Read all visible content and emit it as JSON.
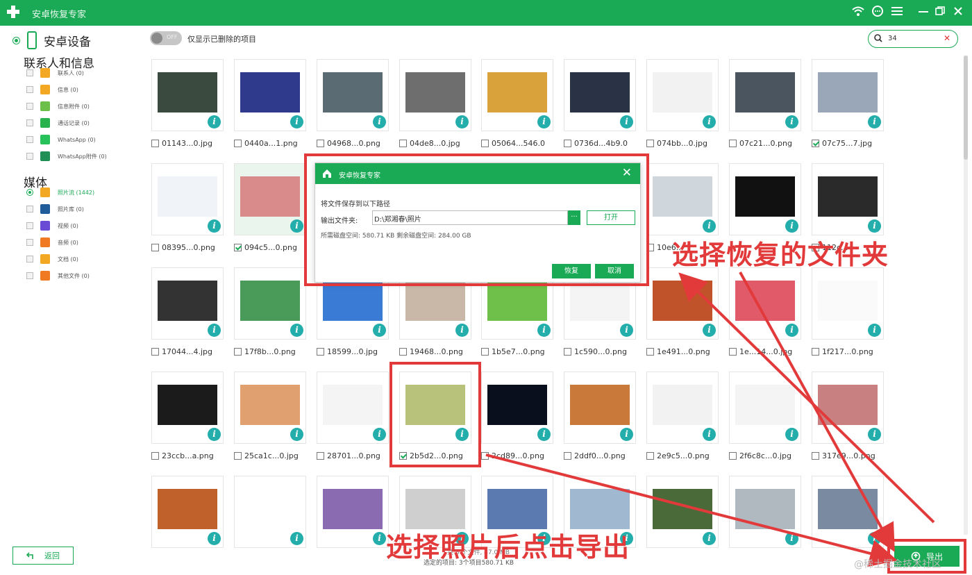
{
  "window": {
    "title": "安卓恢复专家"
  },
  "sidebar": {
    "device_label": "安卓设备",
    "sections": [
      {
        "title": "联系人和信息",
        "items": [
          {
            "label": "联系人 (0)",
            "color": "#f2a822"
          },
          {
            "label": "信息 (0)",
            "color": "#f2a822"
          },
          {
            "label": "信息附件 (0)",
            "color": "#6cc04a"
          },
          {
            "label": "通话记录 (0)",
            "color": "#2ab24f"
          },
          {
            "label": "WhatsApp (0)",
            "color": "#27c25a"
          },
          {
            "label": "WhatsApp附件 (0)",
            "color": "#1f8f55"
          }
        ]
      },
      {
        "title": "媒体",
        "items": [
          {
            "label": "照片流 (1442)",
            "color": "#f2a822",
            "active": true
          },
          {
            "label": "照片库 (0)",
            "color": "#1f5c99"
          },
          {
            "label": "视频 (0)",
            "color": "#6a4bd6"
          },
          {
            "label": "音频 (0)",
            "color": "#f07a22"
          },
          {
            "label": "文档 (0)",
            "color": "#f2a822"
          },
          {
            "label": "其他文件 (0)",
            "color": "#f07a22"
          }
        ]
      }
    ],
    "back_label": "返回"
  },
  "filter": {
    "toggle_text": "OFF",
    "label": "仅显示已删除的项目"
  },
  "search": {
    "value": "34"
  },
  "files": [
    {
      "name": "01143...0.jpg",
      "checked": false
    },
    {
      "name": "0440a...1.png",
      "checked": false
    },
    {
      "name": "04968...0.png",
      "checked": false
    },
    {
      "name": "04de8...0.jpg",
      "checked": false
    },
    {
      "name": "05064...546.0",
      "checked": false
    },
    {
      "name": "0736d...4b9.0",
      "checked": false
    },
    {
      "name": "074bb...0.jpg",
      "checked": false
    },
    {
      "name": "07c21...0.png",
      "checked": false
    },
    {
      "name": "07c75...7.jpg",
      "checked": true
    },
    {
      "name": "08395...0.png",
      "checked": false
    },
    {
      "name": "094c5...0.png",
      "checked": true
    },
    {
      "name": "",
      "checked": false
    },
    {
      "name": "",
      "checked": false
    },
    {
      "name": "",
      "checked": false
    },
    {
      "name": "",
      "checked": false
    },
    {
      "name": "10e6...",
      "checked": false
    },
    {
      "name": "",
      "checked": false
    },
    {
      "name": "112c...",
      "checked": false
    },
    {
      "name": "17044...4.jpg",
      "checked": false
    },
    {
      "name": "17f8b...0.png",
      "checked": false
    },
    {
      "name": "18599...0.jpg",
      "checked": false
    },
    {
      "name": "19468...0.png",
      "checked": false
    },
    {
      "name": "1b5e7...0.png",
      "checked": false
    },
    {
      "name": "1c590...0.png",
      "checked": false
    },
    {
      "name": "1e491...0.png",
      "checked": false
    },
    {
      "name": "1e...14...0.jpg",
      "checked": false
    },
    {
      "name": "1f217...0.png",
      "checked": false
    },
    {
      "name": "23ccb...a.png",
      "checked": false
    },
    {
      "name": "25ca1c...0.jpg",
      "checked": false
    },
    {
      "name": "28701...0.png",
      "checked": false
    },
    {
      "name": "2b5d2...0.png",
      "checked": true
    },
    {
      "name": "2cd89...0.png",
      "checked": false
    },
    {
      "name": "2ddf0...0.png",
      "checked": false
    },
    {
      "name": "2e9c5...0.png",
      "checked": false
    },
    {
      "name": "2f6c8c...0.jpg",
      "checked": false
    },
    {
      "name": "317e9...0.png",
      "checked": false
    }
  ],
  "thumb_colors": [
    "#3b4a3e",
    "#2f3a8c",
    "#5b6b73",
    "#6e6e6e",
    "#d9a23a",
    "#2a3346",
    "#f2f2f2",
    "#4a5560",
    "#9aa7b8",
    "#f0f4f8",
    "#d98a8a",
    "#ffffff",
    "#ffffff",
    "#ffffff",
    "#ffffff",
    "#cfd6dc",
    "#111111",
    "#2a2a2a",
    "#333333",
    "#4a9a5a",
    "#3a7bd5",
    "#c9b8a8",
    "#6fc04a",
    "#f4f4f4",
    "#c0532a",
    "#e05a6a",
    "#fafafa",
    "#1b1b1b",
    "#e0a070",
    "#f4f4f4",
    "#b8c27a",
    "#0a0f1e",
    "#c97a3a",
    "#f2f2f2",
    "#f4f4f4",
    "#c88080",
    "#c0602a",
    "#ffffff",
    "#8a6ab0",
    "#cfcfcf",
    "#5a7ab0",
    "#a0b8d0",
    "#4a6a3a",
    "#b0b8c0",
    "#7a8aa0"
  ],
  "status": {
    "line1": "共 8 个文件, 47.0 MB",
    "line2": "选定的项目: 3个项目580.71 KB"
  },
  "export_label": "导出",
  "dialog": {
    "title": "安卓恢复专家",
    "save_prompt": "将文件保存到以下路径",
    "folder_label": "输出文件夹:",
    "path_value": "D:\\郑湘春\\照片",
    "browse_label": "···",
    "open_label": "打开",
    "space_info": "所需磁盘空间:  580.71 KB  剩余磁盘空间:  284.00 GB",
    "ok_label": "恢复",
    "cancel_label": "取消"
  },
  "annotations": {
    "folder_tip": "选择恢复的文件夹",
    "export_tip": "选择照片后点击导出"
  },
  "watermark": "@稀土掘金技术社区"
}
